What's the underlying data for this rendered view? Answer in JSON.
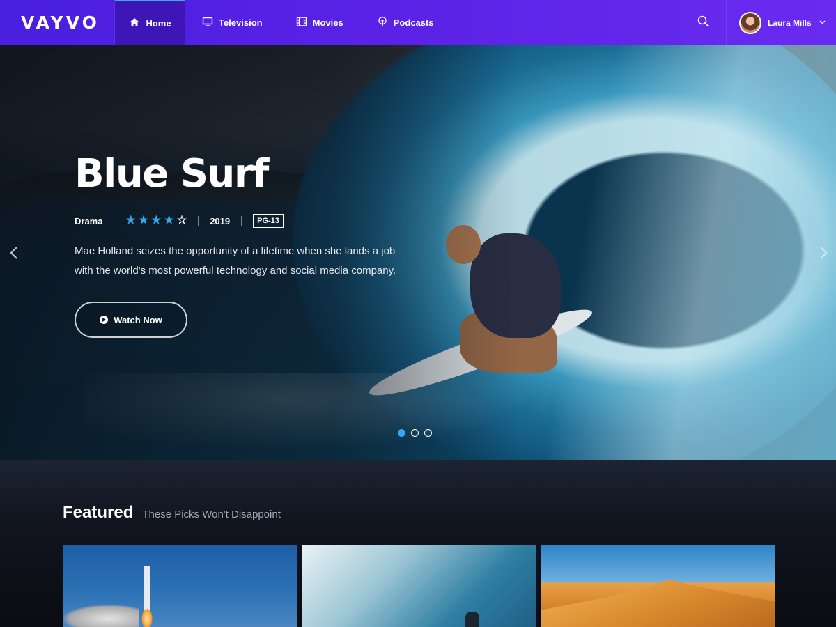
{
  "brand": {
    "logo_text": "VAYVO"
  },
  "nav": {
    "items": [
      {
        "label": "Home",
        "icon": "home-icon",
        "active": true
      },
      {
        "label": "Television",
        "icon": "tv-icon",
        "active": false
      },
      {
        "label": "Movies",
        "icon": "film-icon",
        "active": false
      },
      {
        "label": "Podcasts",
        "icon": "podcast-icon",
        "active": false
      }
    ],
    "search_icon": "search-icon"
  },
  "user": {
    "name": "Laura Mills",
    "caret_icon": "chevron-down-icon"
  },
  "hero": {
    "title": "Blue Surf",
    "genre": "Drama",
    "rating_stars": 4,
    "rating_max": 5,
    "year": "2019",
    "maturity": "PG-13",
    "description": "Mae Holland seizes the opportunity of a lifetime when she lands a job with the world's most powerful technology and social media company.",
    "cta_label": "Watch Now",
    "slide_count": 3,
    "active_slide": 1
  },
  "featured": {
    "title": "Featured",
    "subtitle": "These Picks Won't Disappoint",
    "cards": [
      {
        "name": "rocket-launch-card"
      },
      {
        "name": "wave-card"
      },
      {
        "name": "desert-card"
      }
    ]
  },
  "colors": {
    "nav_start": "#4a1fe0",
    "nav_end": "#6a2bf0",
    "accent": "#35a8f2",
    "star": "#34a7ef",
    "page_bg": "#0c0d14"
  }
}
